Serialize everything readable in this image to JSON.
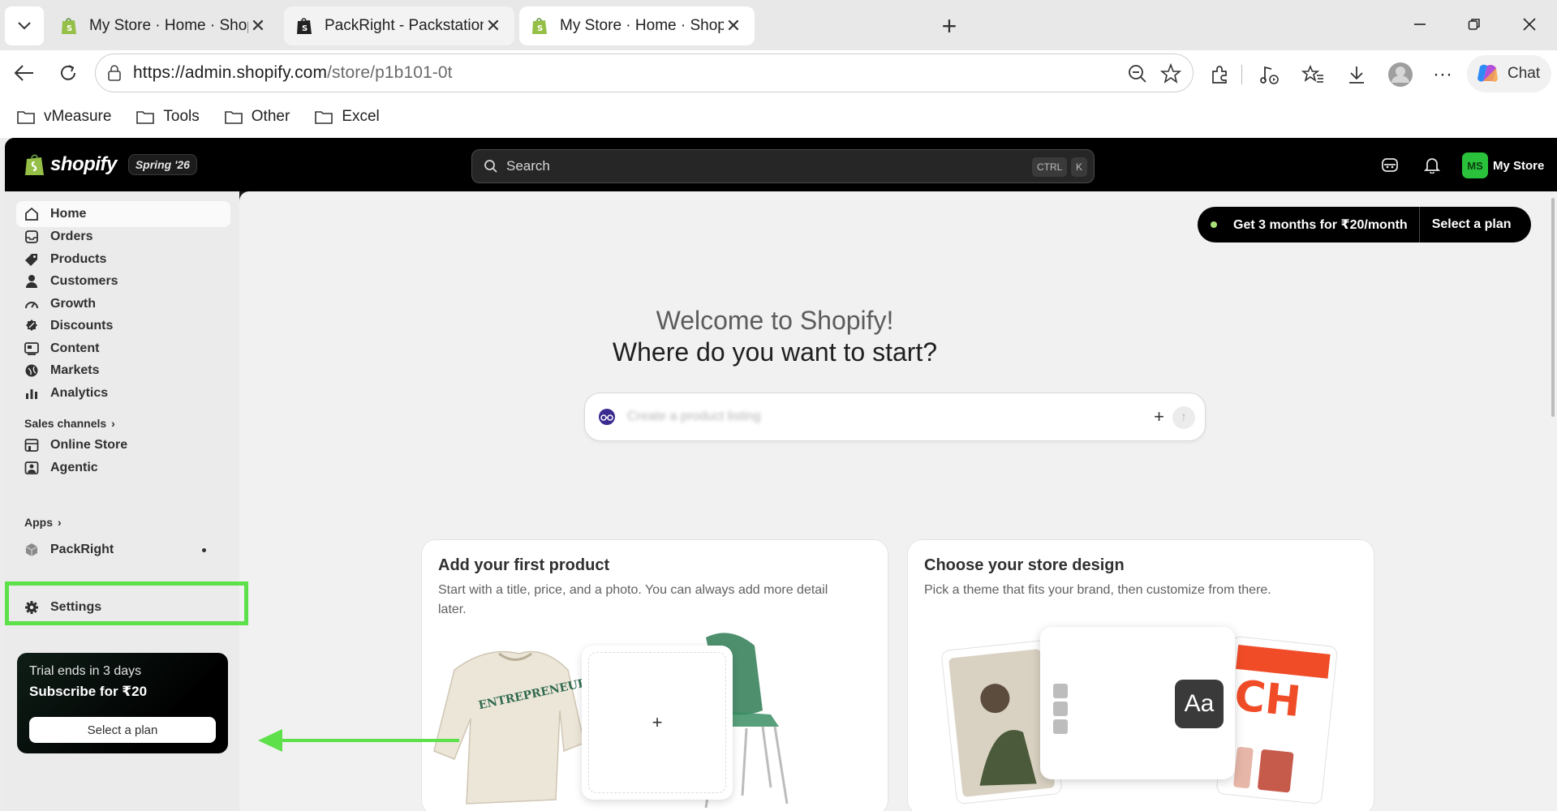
{
  "browser": {
    "tabs": [
      {
        "title": "My Store · Home · Shopify",
        "state": "inactive"
      },
      {
        "title": "PackRight - Packstation VMS - Veri",
        "state": "inactive"
      },
      {
        "title": "My Store · Home · Shopify",
        "state": "active"
      }
    ],
    "url_host": "https://admin.shopify.com",
    "url_path": "/store/p1b101-0t",
    "copilot_label": "Chat",
    "bookmarks": [
      "vMeasure",
      "Tools",
      "Other",
      "Excel"
    ]
  },
  "topbar": {
    "logo_text": "shopify",
    "edition_badge": "Spring '26",
    "search_placeholder": "Search",
    "shortcut_key1": "CTRL",
    "shortcut_key2": "K",
    "store_initials": "MS",
    "store_name": "My Store"
  },
  "sidebar": {
    "items": [
      {
        "label": "Home",
        "icon": "home-icon"
      },
      {
        "label": "Orders",
        "icon": "orders-icon"
      },
      {
        "label": "Products",
        "icon": "tag-icon"
      },
      {
        "label": "Customers",
        "icon": "person-icon"
      },
      {
        "label": "Growth",
        "icon": "gauge-icon"
      },
      {
        "label": "Discounts",
        "icon": "discount-icon"
      },
      {
        "label": "Content",
        "icon": "content-icon"
      },
      {
        "label": "Markets",
        "icon": "globe-icon"
      },
      {
        "label": "Analytics",
        "icon": "bar-chart-icon"
      }
    ],
    "sales_channels_label": "Sales channels",
    "channels": [
      {
        "label": "Online Store",
        "icon": "store-icon"
      },
      {
        "label": "Agentic",
        "icon": "agent-icon"
      }
    ],
    "apps_label": "Apps",
    "apps": [
      {
        "label": "PackRight",
        "icon": "app-cube-icon"
      }
    ],
    "settings_label": "Settings",
    "trial": {
      "line1": "Trial ends in 3 days",
      "line2": "Subscribe for ₹20",
      "button": "Select a plan"
    }
  },
  "main": {
    "promo_text": "Get 3 months for ₹20/month",
    "promo_button": "Select a plan",
    "welcome_line1": "Welcome to Shopify!",
    "welcome_line2": "Where do you want to start?",
    "prompt_placeholder": "Create a product listing",
    "cards": [
      {
        "title": "Add your first product",
        "description": "Start with a title, price, and a photo. You can always add more detail later."
      },
      {
        "title": "Choose your store design",
        "description": "Pick a theme that fits your brand, then customize from there."
      }
    ],
    "add_tile_symbol": "+",
    "font_tile_text": "Aa",
    "sweater_text": "ENTREPRENEUR"
  },
  "annotation": {
    "highlight_color": "#5de04a",
    "target": "PackRight"
  },
  "colors": {
    "topbar": "#000000",
    "sidebar": "#ebebeb",
    "main_bg": "#f1f1f1",
    "accent_green": "#29c23a"
  }
}
